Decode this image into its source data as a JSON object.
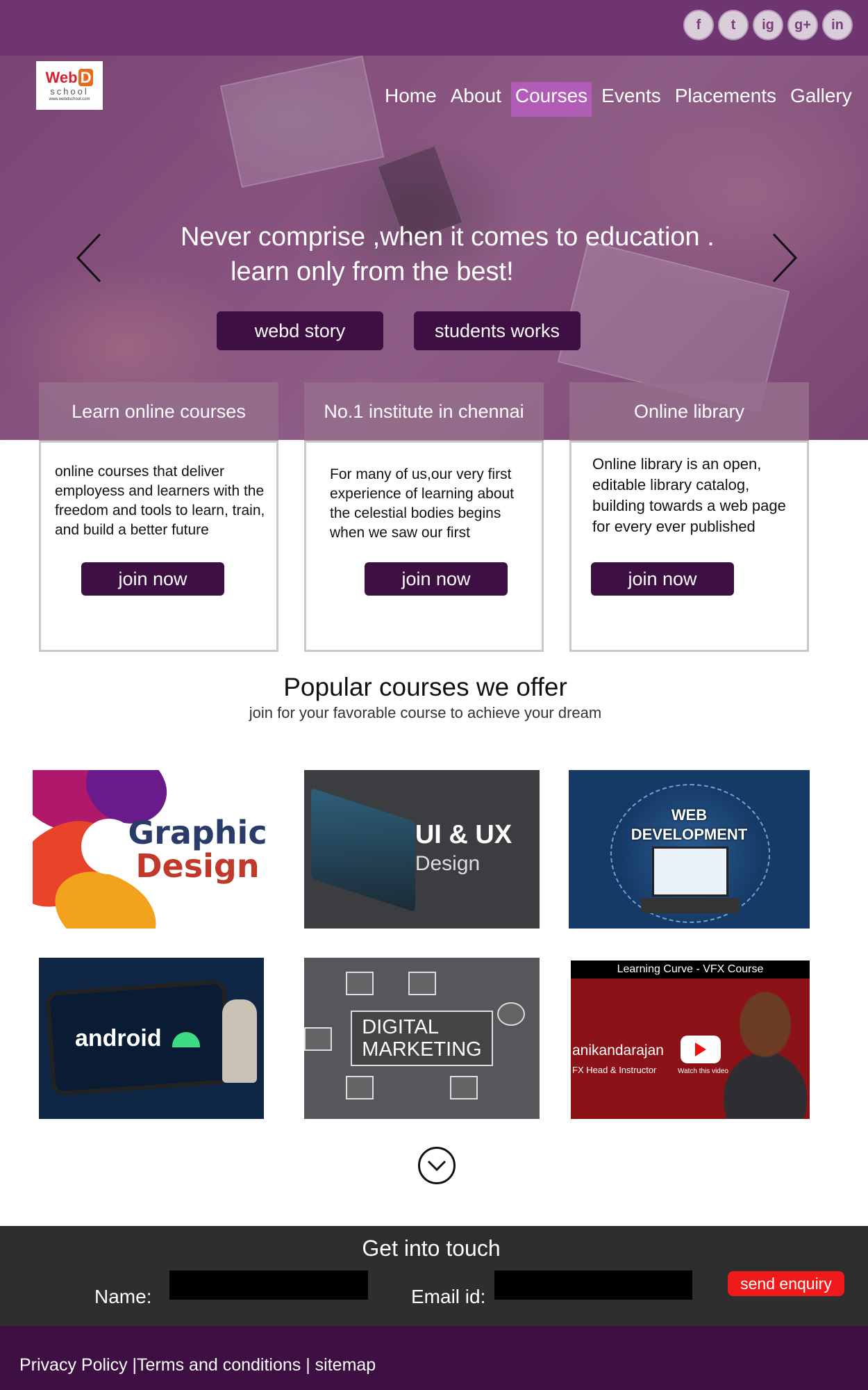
{
  "colors": {
    "topbar": "#6e3570",
    "button": "#3d0f42",
    "nav_active": "#be5fc8",
    "contact_bg": "#2e2e2e",
    "footer_bg": "#3d0f42",
    "send_button": "#f01a1a"
  },
  "social": [
    "f",
    "t",
    "ig",
    "g+",
    "in"
  ],
  "social_icons": [
    "facebook-icon",
    "twitter-icon",
    "instagram-icon",
    "google-plus-icon",
    "linkedin-icon"
  ],
  "logo": {
    "main": "Web",
    "badge": "D",
    "sub": "school",
    "url": "www.webdschool.com"
  },
  "nav": {
    "items": [
      "Home",
      "About",
      "Courses",
      "Events",
      "Placements",
      "Gallery"
    ],
    "active": "Courses"
  },
  "hero": {
    "line1": "Never comprise ,when it comes  to education .",
    "line2": "learn only from the best!",
    "btn_story": "webd story",
    "btn_works": "students works"
  },
  "cards": [
    {
      "title": "Learn online courses",
      "text": "online  courses that deliver employess and learners with the freedom and tools to  learn, train, and build  a better  future",
      "button": "join now"
    },
    {
      "title": "No.1 institute in chennai",
      "text": "For many of us,our very first experience of learning about the celestial bodies begins when we saw our first",
      "button": "join now"
    },
    {
      "title": "Online  library",
      "text": "Online library is an open, editable library catalog, building towards a web page for every ever published",
      "button": "join now"
    }
  ],
  "popular": {
    "title": "Popular courses we offer",
    "subtitle": "join for your  favorable course to achieve your dream"
  },
  "courses": {
    "graphic": {
      "line1": "Graphic",
      "line2": "Design"
    },
    "uiux": {
      "title": "UI & UX",
      "sub": "Design"
    },
    "web": {
      "line1": "WEB",
      "line2": "DEVELOPMENT"
    },
    "android": {
      "label": "android"
    },
    "digital": {
      "line1": "DIGITAL",
      "line2": "MARKETING"
    },
    "vfx": {
      "header": "Learning Curve - VFX Course",
      "name": "anikandarajan",
      "role": "FX Head & Instructor",
      "watch": "Watch this video"
    }
  },
  "contact": {
    "title": "Get into touch",
    "name_label": "Name:",
    "email_label": "Email id:",
    "send": "send enquiry"
  },
  "footer": {
    "privacy": "Privacy Policy",
    "terms": "Terms and conditions",
    "sitemap": "sitemap"
  }
}
